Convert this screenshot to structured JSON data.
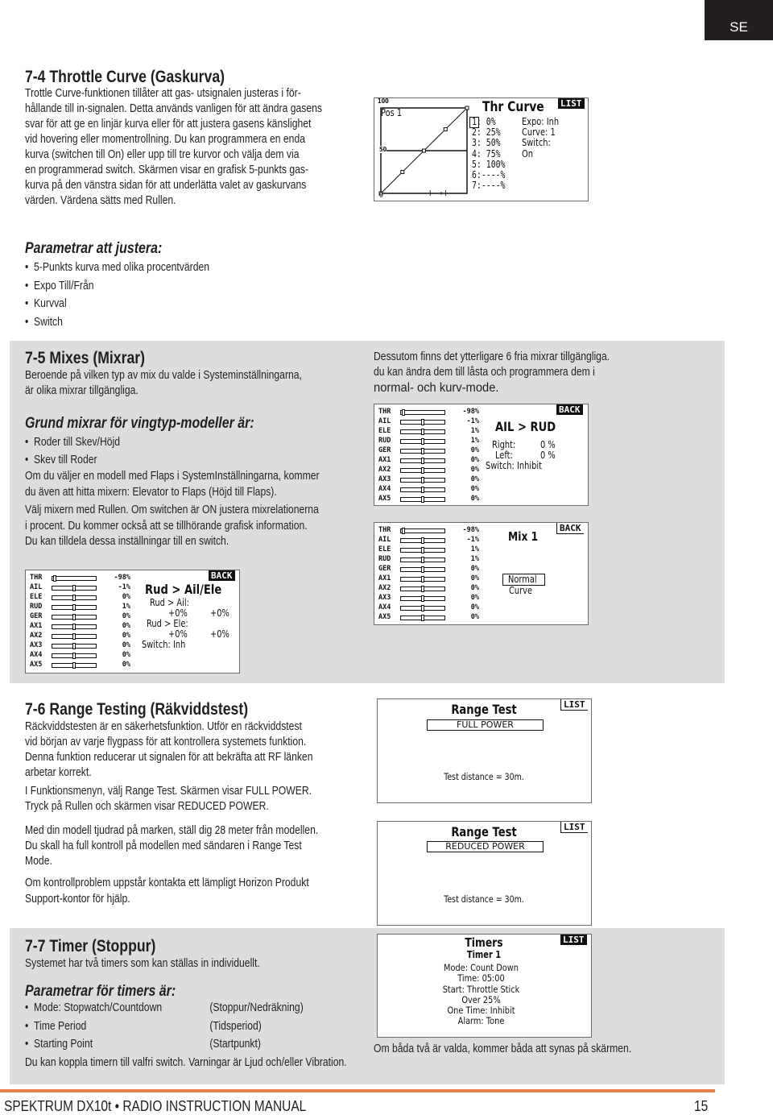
{
  "lang_tab": "SE",
  "s74": {
    "heading": "7-4 Throttle Curve (Gaskurva)",
    "lines": [
      "Trottle Curve-funktionen tillåter att gas- utsignalen justeras  i för-",
      "hållande till in-signalen. Detta används vanligen för att ändra gasens",
      "svar för att ge en linjär kurva eller för att justera gasens känslighet",
      "vid hovering eller momentrollning. Du kan programmera en enda",
      "kurva (switchen till On) eller upp till tre kurvor och välja dem via",
      "en programmerad switch. Skärmen visar en grafisk 5-punkts gas-",
      "kurva på den vänstra sidan för att underlätta valet av gaskurvans",
      "värden. Värdena sätts med Rullen."
    ],
    "params_heading": "Parametrar att justera:",
    "params": [
      "5-Punkts kurva med olika procentvärden",
      "Expo Till/Från",
      "Kurvval",
      "Switch"
    ]
  },
  "thr_screen": {
    "title": "Thr Curve",
    "list": "LIST",
    "y_top": "100",
    "y_mid": "50",
    "y_bot": "0",
    "pos": "Pos 1",
    "curve_points": [
      0,
      25,
      50,
      75,
      100
    ],
    "rows": [
      "1:   0%",
      "2:  25%",
      "3:  50%",
      "4:  75%",
      "5: 100%",
      "6:----%",
      "7:----%"
    ],
    "side": [
      "Expo: Inh",
      "Curve: 1",
      "Switch:",
      "On"
    ],
    "arrow": "I ⟶ I"
  },
  "s75": {
    "heading": "7-5 Mixes  (Mixrar)",
    "lines": [
      "Beroende på vilken typ av mix du valde i Systeminställningarna,",
      "är olika mixrar tillgängliga."
    ],
    "right_lines": [
      "Dessutom finns det ytterligare 6 fria mixrar tillgängliga.",
      "du kan ändra dem till låsta och programmera dem i"
    ],
    "right_last": "normal- och kurv-mode.",
    "sub_heading": "Grund mixrar för vingtyp-modeller är:",
    "bullets": [
      "Roder till Skev/Höjd",
      "Skev till Roder"
    ],
    "p1": [
      "Om du väljer en modell med Flaps i SystemInställningarna, kommer",
      "du även att hitta mixern: Elevator to Flaps (Höjd till Flaps)."
    ],
    "p2": [
      "Välj mixern med Rullen. Om  switchen är ON justera mixrelationerna",
      "i procent. Du kommer också att se tillhörande grafisk information.",
      "Du kan tilldela dessa inställningar till en switch."
    ]
  },
  "ail_rud": {
    "back": "BACK",
    "title": "AIL > RUD",
    "right_label": "Right:",
    "right_val": "0 %",
    "left_label": "Left:",
    "left_val": "0 %",
    "switch": "Switch: Inhibit",
    "channels": [
      [
        "THR",
        "-98%",
        -98
      ],
      [
        "AIL",
        "-1%",
        -1
      ],
      [
        "ELE",
        "1%",
        1
      ],
      [
        "RUD",
        "1%",
        1
      ],
      [
        "GER",
        "0%",
        0
      ],
      [
        "AX1",
        "0%",
        0
      ],
      [
        "AX2",
        "0%",
        0
      ],
      [
        "AX3",
        "0%",
        0
      ],
      [
        "AX4",
        "0%",
        0
      ],
      [
        "AX5",
        "0%",
        0
      ]
    ]
  },
  "mix1": {
    "back": "BACK",
    "title": "Mix 1",
    "normal": "Normal",
    "curve": "Curve",
    "channels": [
      [
        "THR",
        "-98%",
        -98
      ],
      [
        "AIL",
        "-1%",
        -1
      ],
      [
        "ELE",
        "1%",
        1
      ],
      [
        "RUD",
        "1%",
        1
      ],
      [
        "GER",
        "0%",
        0
      ],
      [
        "AX1",
        "0%",
        0
      ],
      [
        "AX2",
        "0%",
        0
      ],
      [
        "AX3",
        "0%",
        0
      ],
      [
        "AX4",
        "0%",
        0
      ],
      [
        "AX5",
        "0%",
        0
      ]
    ]
  },
  "rud_ail": {
    "back": "BACK",
    "title": "Rud > Ail/Ele",
    "l1": "Rud > Ail:",
    "v1a": "+0%",
    "v1b": "+0%",
    "l2": "Rud > Ele:",
    "v2a": "+0%",
    "v2b": "+0%",
    "switch": "Switch: Inh",
    "channels": [
      [
        "THR",
        "-98%",
        -98
      ],
      [
        "AIL",
        "-1%",
        -1
      ],
      [
        "ELE",
        "0%",
        0
      ],
      [
        "RUD",
        "1%",
        1
      ],
      [
        "GER",
        "0%",
        0
      ],
      [
        "AX1",
        "0%",
        0
      ],
      [
        "AX2",
        "0%",
        0
      ],
      [
        "AX3",
        "0%",
        0
      ],
      [
        "AX4",
        "0%",
        0
      ],
      [
        "AX5",
        "0%",
        0
      ]
    ]
  },
  "s76": {
    "heading": "7-6 Range Testing  (Räkviddstest)",
    "p1": [
      "Räckviddstesten är en säkerhetsfunktion. Utför en räckviddstest",
      "vid början av varje flygpass för att kontrollera systemets funktion.",
      "Denna funktion reducerar ut signalen för att bekräfta att RF länken",
      "arbetar korrekt."
    ],
    "p2": [
      "I Funktionsmenyn, välj Range Test. Skärmen visar FULL POWER.",
      "Tryck på Rullen och skärmen visar REDUCED POWER."
    ],
    "p3": [
      "Med din modell tjudrad på marken, ställ dig 28 meter från modellen.",
      "Du skall ha full kontroll på modellen med sändaren i Range Test",
      "Mode."
    ],
    "p4": [
      "Om kontrollproblem uppstår kontakta ett lämpligt Horizon Produkt",
      "Support-kontor för hjälp."
    ]
  },
  "range_full": {
    "title": "Range Test",
    "list": "LIST",
    "mode": "FULL POWER",
    "distance": "Test distance = 30m."
  },
  "range_reduced": {
    "title": "Range Test",
    "list": "LIST",
    "mode": "REDUCED POWER",
    "distance": "Test distance = 30m."
  },
  "s77": {
    "heading": "7-7 Timer  (Stoppur)",
    "intro": "Systemet har två timers som kan ställas in individuellt.",
    "params_heading": "Parametrar för timers är:",
    "params": [
      [
        "Mode:  Stopwatch/Countdown",
        "(Stoppur/Nedräkning)"
      ],
      [
        "Time Period",
        "(Tidsperiod)"
      ],
      [
        "Starting Point",
        "(Startpunkt)"
      ]
    ],
    "outro": "Du kan koppla timern till valfri switch. Varningar är Ljud och/eller Vibration.",
    "note": "Om båda två är valda, kommer båda att synas på skärmen."
  },
  "timer_screen": {
    "title": "Timers",
    "list": "LIST",
    "subtitle": "Timer 1",
    "lines": [
      "Mode: Count Down",
      "Time: 05:00",
      "Start: Throttle Stick",
      "Over   25%",
      "One Time: Inhibit",
      "Alarm: Tone"
    ]
  },
  "footer": {
    "title": "SPEKTRUM DX10t • RADIO INSTRUCTION MANUAL",
    "page": "15"
  },
  "colors": {
    "accent_line": "#e8824a",
    "section_bg": "#dcdddf"
  }
}
